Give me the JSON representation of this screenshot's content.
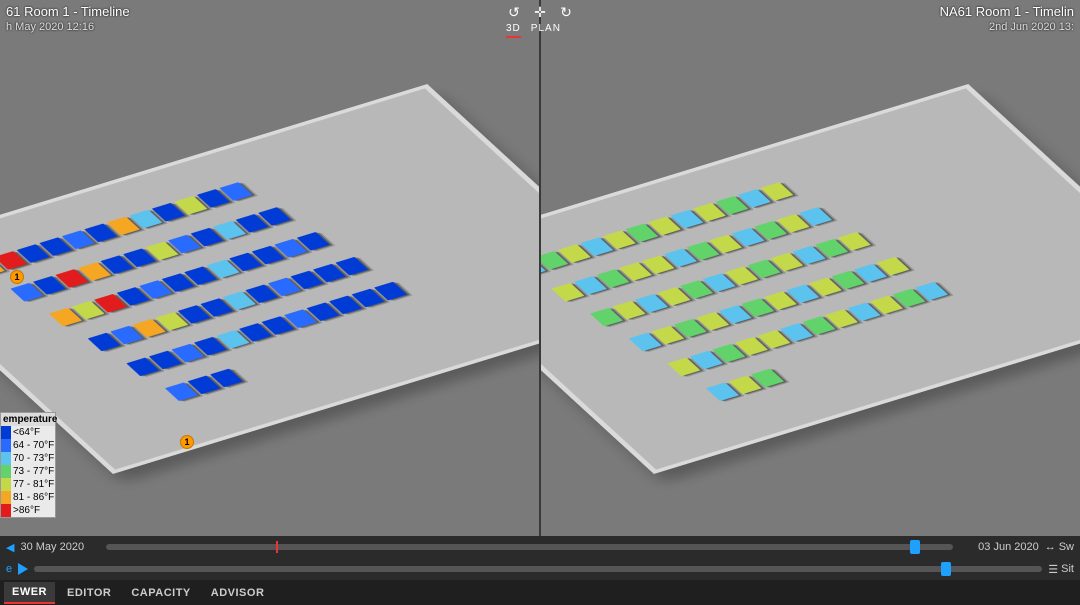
{
  "center_controls": {
    "modes": [
      {
        "label": "3D",
        "active": true
      },
      {
        "label": "PLAN",
        "active": false
      }
    ],
    "icons": [
      "rotate-ccw-icon",
      "recenter-icon",
      "rotate-cw-icon"
    ]
  },
  "left_view": {
    "title": "61 Room 1 - Timeline",
    "subtitle": "h May 2020 12:16"
  },
  "right_view": {
    "title": "NA61 Room 1 - Timelin",
    "subtitle": "2nd Jun 2020 13:"
  },
  "legend": {
    "title": "emperature",
    "rows": [
      {
        "label": "<64°F",
        "color": "#003bd6"
      },
      {
        "label": "64 - 70°F",
        "color": "#2a6bff"
      },
      {
        "label": "70 - 73°F",
        "color": "#5cc3ef"
      },
      {
        "label": "73 - 77°F",
        "color": "#62d36a"
      },
      {
        "label": "77 - 81°F",
        "color": "#c4d94a"
      },
      {
        "label": "81 - 86°F",
        "color": "#f5a623"
      },
      {
        "label": ">86°F",
        "color": "#e21c1c"
      }
    ]
  },
  "timeline": {
    "upper": {
      "start": "30 May 2020",
      "end": "03 Jun 2020",
      "swap": "Sw",
      "tick_pct": 20,
      "marker_pct": 95
    },
    "lower": {
      "start_label": "e",
      "end": "Sit",
      "marker_pct": 90
    }
  },
  "tabs": [
    {
      "label": "EWER",
      "active": true
    },
    {
      "label": "EDITOR",
      "active": false
    },
    {
      "label": "CAPACITY",
      "active": false
    },
    {
      "label": "ADVISOR",
      "active": false
    }
  ],
  "alert_pin_text": "1"
}
